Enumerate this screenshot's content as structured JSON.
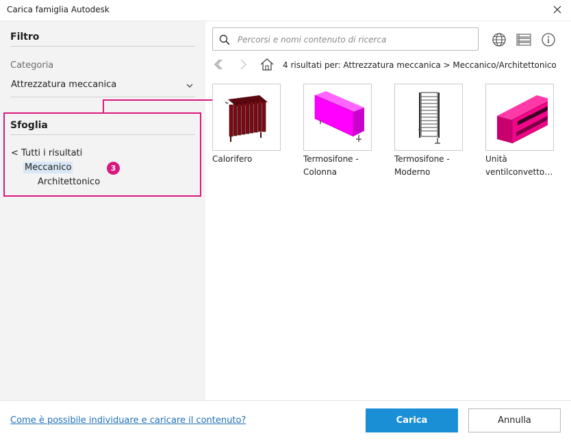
{
  "window": {
    "title": "Carica famiglia Autodesk"
  },
  "filter": {
    "heading": "Filtro",
    "category_label": "Categoria",
    "category_value": "Attrezzatura meccanica"
  },
  "browse": {
    "heading": "Sfoglia",
    "all_results": "< Tutti i risultati",
    "tree": [
      "Meccanico",
      "Architettonico"
    ],
    "callout_number": "3"
  },
  "search": {
    "placeholder": "Percorsi e nomi contenuto di ricerca",
    "value": ""
  },
  "toolbar": {
    "icons": [
      "globe-icon",
      "list-view-icon",
      "info-icon"
    ]
  },
  "navigation": {
    "results_text": "4 risultati  per:  Attrezzatura meccanica > Meccanico/Architettonico",
    "icons": [
      "back-icon",
      "forward-icon",
      "home-icon"
    ]
  },
  "items": [
    {
      "name_line1": "Calorifero",
      "name_line2": "",
      "color": "#7a0a14"
    },
    {
      "name_line1": "Termosifone -",
      "name_line2": "Colonna",
      "color": "#ff00ff"
    },
    {
      "name_line1": "Termosifone -",
      "name_line2": "Moderno",
      "color": "#555555"
    },
    {
      "name_line1": "Unità",
      "name_line2": "ventilconvetto…",
      "color": "#f0068a"
    }
  ],
  "footer": {
    "help_link": "Come è possibile individuare e caricare il contenuto?",
    "load_button": "Carica",
    "cancel_button": "Annulla"
  },
  "colors": {
    "accent": "#1a8fd6",
    "callout": "#d8197e",
    "link": "#1f6fb7"
  }
}
